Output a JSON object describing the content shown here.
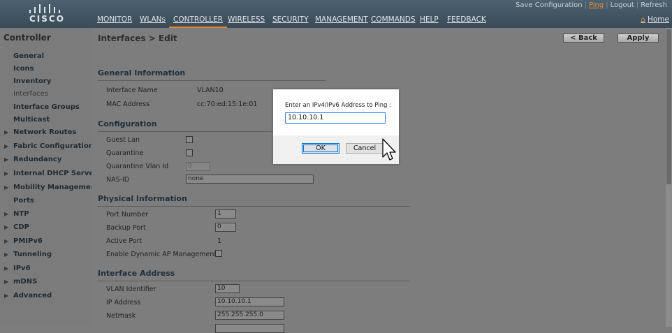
{
  "brand": {
    "logo_text": "CISCO"
  },
  "top_links": [
    "Save Configuration",
    "Ping",
    "Logout",
    "Refresh"
  ],
  "nav": [
    "MONITOR",
    "WLANs",
    "CONTROLLER",
    "WIRELESS",
    "SECURITY",
    "MANAGEMENT",
    "COMMANDS",
    "HELP",
    "FEEDBACK"
  ],
  "nav_active": "CONTROLLER",
  "home_label": "Home",
  "sidebar": {
    "title": "Controller",
    "items": [
      {
        "label": "General",
        "expandable": false
      },
      {
        "label": "Icons",
        "expandable": false
      },
      {
        "label": "Inventory",
        "expandable": false
      },
      {
        "label": "Interfaces",
        "expandable": false,
        "current": true
      },
      {
        "label": "Interface Groups",
        "expandable": false
      },
      {
        "label": "Multicast",
        "expandable": false
      },
      {
        "label": "Network Routes",
        "expandable": true
      },
      {
        "label": "Fabric Configuration",
        "expandable": true
      },
      {
        "label": "Redundancy",
        "expandable": true
      },
      {
        "label": "Internal DHCP Server",
        "expandable": true
      },
      {
        "label": "Mobility Management",
        "expandable": true
      },
      {
        "label": "Ports",
        "expandable": false
      },
      {
        "label": "NTP",
        "expandable": true
      },
      {
        "label": "CDP",
        "expandable": true
      },
      {
        "label": "PMIPv6",
        "expandable": true
      },
      {
        "label": "Tunneling",
        "expandable": true
      },
      {
        "label": "IPv6",
        "expandable": true
      },
      {
        "label": "mDNS",
        "expandable": true
      },
      {
        "label": "Advanced",
        "expandable": true
      }
    ]
  },
  "main": {
    "breadcrumb": "Interfaces > Edit",
    "back_label": "< Back",
    "apply_label": "Apply",
    "general": {
      "title": "General Information",
      "interface_name_label": "Interface Name",
      "interface_name": "VLAN10",
      "mac_label": "MAC Address",
      "mac": "cc:70:ed:15:1e:01"
    },
    "configuration": {
      "title": "Configuration",
      "guest_lan_label": "Guest Lan",
      "quarantine_label": "Quarantine",
      "quarantine_vlan_label": "Quarantine Vlan Id",
      "quarantine_vlan": "0",
      "nas_id_label": "NAS-ID",
      "nas_id": "none"
    },
    "physical": {
      "title": "Physical Information",
      "port_number_label": "Port Number",
      "port_number": "1",
      "backup_port_label": "Backup Port",
      "backup_port": "0",
      "active_port_label": "Active Port",
      "active_port": "1",
      "dynamic_ap_label": "Enable Dynamic AP Management"
    },
    "address": {
      "title": "Interface Address",
      "vlan_id_label": "VLAN Identifier",
      "vlan_id": "10",
      "ip_label": "IP Address",
      "ip": "10.10.10.1",
      "netmask_label": "Netmask",
      "netmask": "255.255.255.0"
    }
  },
  "dialog": {
    "prompt": "Enter an IPv4/IPv6 Address to Ping :",
    "value": "10.10.10.1",
    "ok_label": "OK",
    "cancel_label": "Cancel"
  }
}
